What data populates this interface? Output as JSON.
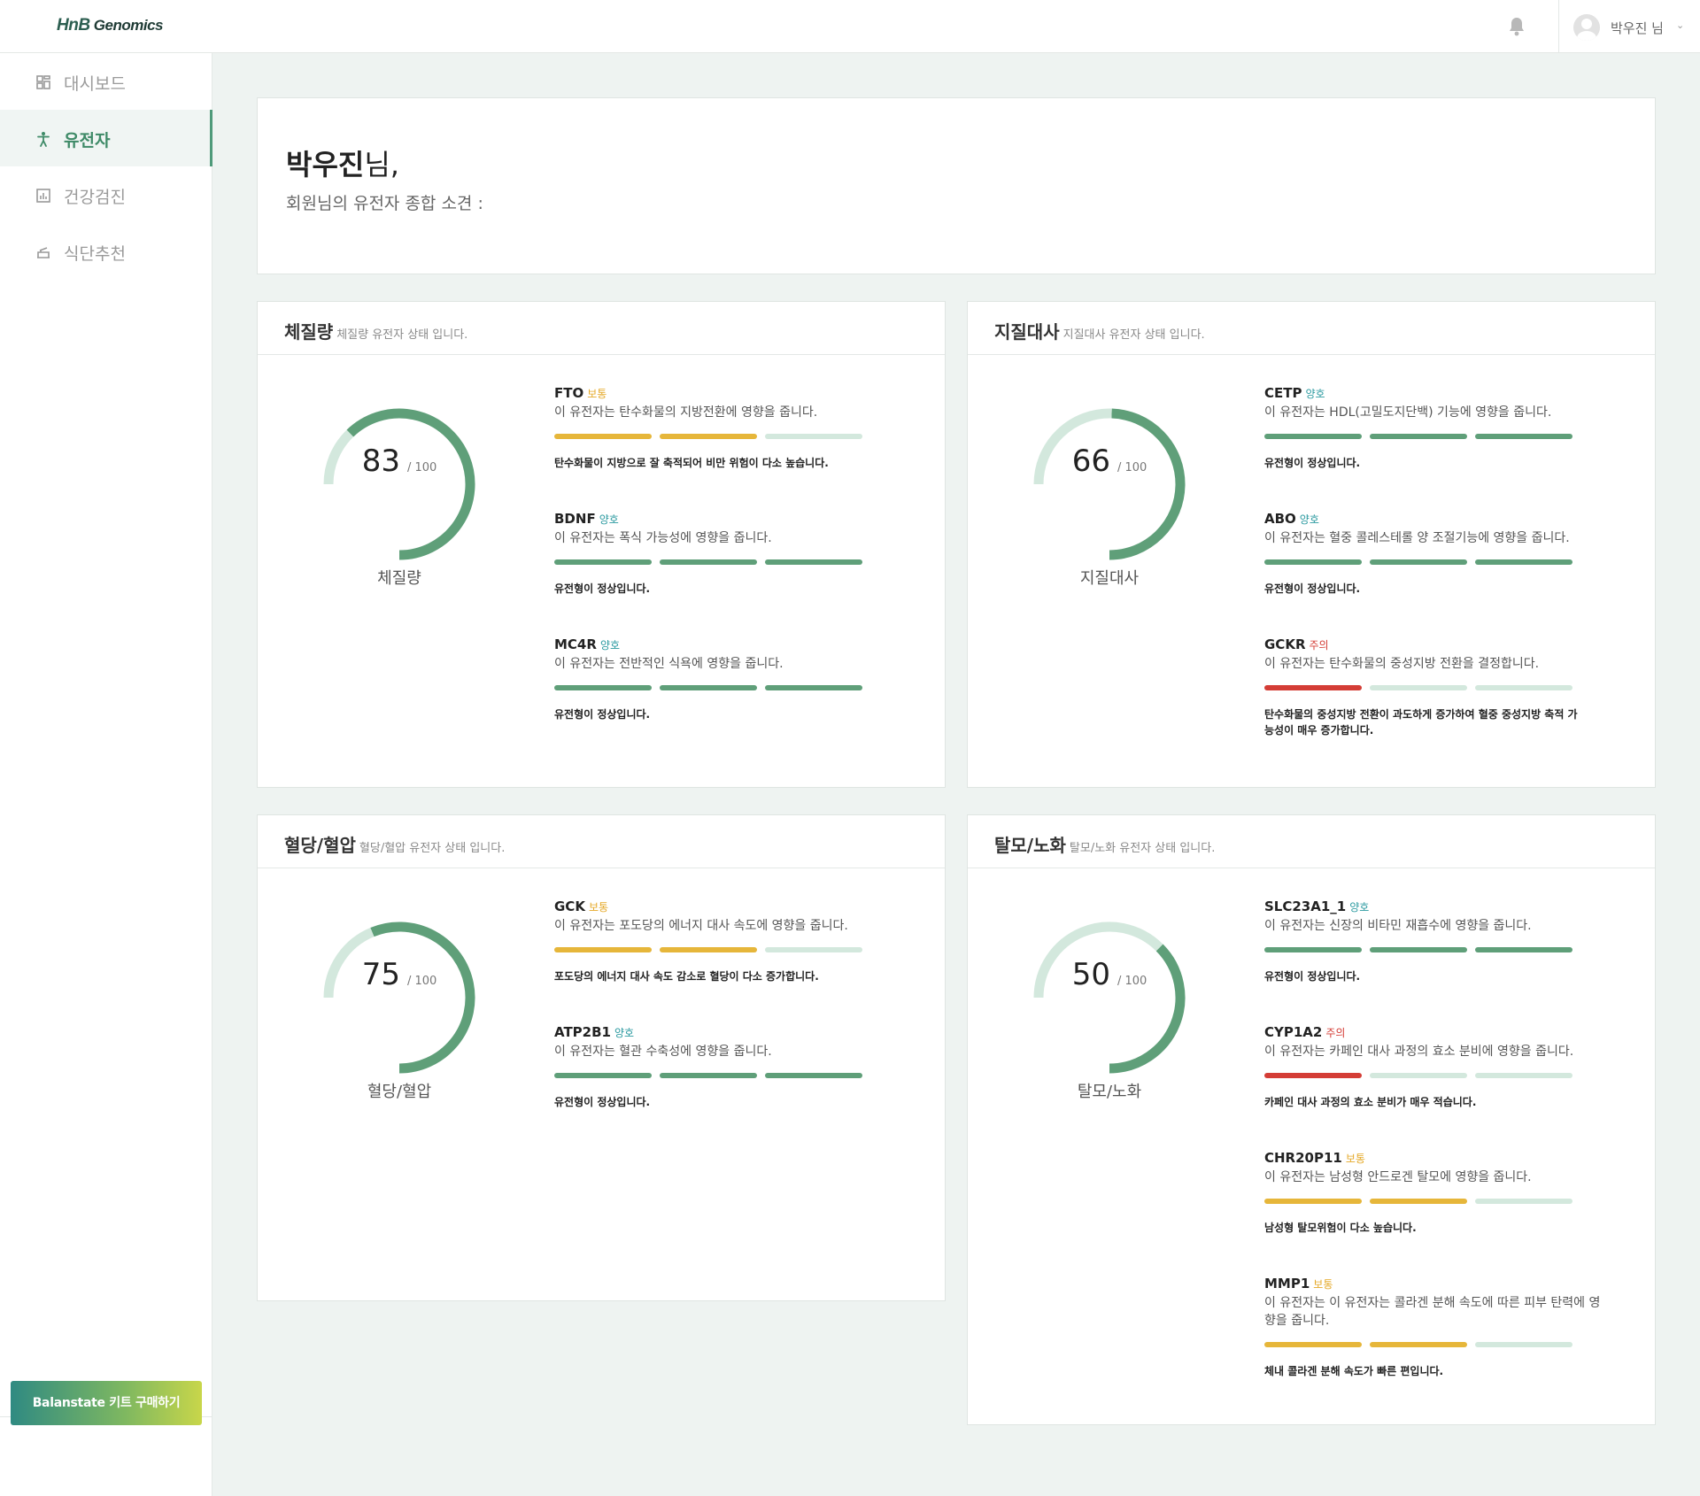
{
  "header": {
    "logo_hnb": "HnB",
    "logo_rest": "Genomics",
    "user_name": "박우진 님",
    "user_chevron": "⌄"
  },
  "sidebar": {
    "items": [
      {
        "label": "대시보드",
        "icon": "dashboard-icon",
        "active": false
      },
      {
        "label": "유전자",
        "icon": "person-icon",
        "active": true
      },
      {
        "label": "건강검진",
        "icon": "chart-icon",
        "active": false
      },
      {
        "label": "식단추천",
        "icon": "food-icon",
        "active": false
      }
    ],
    "buy_button": "Balanstate 키트 구매하기"
  },
  "greeting": {
    "name": "박우진",
    "suffix": "님,",
    "subtitle": "회원님의 유전자 종합 소견 :"
  },
  "colors": {
    "accent": "#5f9f79",
    "track": "#d3e8dd",
    "good": "#2b9aa0",
    "mid": "#e5a928",
    "bad": "#d43d36"
  },
  "cards": [
    {
      "title": "체질량",
      "desc": "체질량 유전자 상태 입니다.",
      "score": 83,
      "max": "/ 100",
      "gauge_label": "체질량",
      "genes": [
        {
          "name": "FTO",
          "status": "보통",
          "level": "mid",
          "desc": "이 유전자는 탄수화물의 지방전환에 영향을 줍니다.",
          "result": "탄수화물이 지방으로 잘 축적되어 비만 위험이 다소 높습니다.",
          "bars": [
            "y",
            "y",
            "t"
          ]
        },
        {
          "name": "BDNF",
          "status": "양호",
          "level": "good",
          "desc": "이 유전자는 폭식 가능성에 영향을 줍니다.",
          "result": "유전형이 정상입니다.",
          "bars": [
            "g",
            "g",
            "g"
          ]
        },
        {
          "name": "MC4R",
          "status": "양호",
          "level": "good",
          "desc": "이 유전자는 전반적인 식욕에 영향을 줍니다.",
          "result": "유전형이 정상입니다.",
          "bars": [
            "g",
            "g",
            "g"
          ]
        }
      ]
    },
    {
      "title": "지질대사",
      "desc": "지질대사 유전자 상태 입니다.",
      "score": 66,
      "max": "/ 100",
      "gauge_label": "지질대사",
      "genes": [
        {
          "name": "CETP",
          "status": "양호",
          "level": "good",
          "desc": "이 유전자는 HDL(고밀도지단백) 기능에 영향을 줍니다.",
          "result": "유전형이 정상입니다.",
          "bars": [
            "g",
            "g",
            "g"
          ]
        },
        {
          "name": "ABO",
          "status": "양호",
          "level": "good",
          "desc": "이 유전자는 혈중 콜레스테롤 양 조절기능에 영향을 줍니다.",
          "result": "유전형이 정상입니다.",
          "bars": [
            "g",
            "g",
            "g"
          ]
        },
        {
          "name": "GCKR",
          "status": "주의",
          "level": "bad",
          "desc": "이 유전자는 탄수화물의 중성지방 전환을 결정합니다.",
          "result": "탄수화물의 중성지방 전환이 과도하게 증가하여 혈중 중성지방 축적 가능성이 매우 증가합니다.",
          "bars": [
            "r",
            "t",
            "t"
          ]
        }
      ]
    },
    {
      "title": "혈당/혈압",
      "desc": "혈당/혈압 유전자 상태 입니다.",
      "score": 75,
      "max": "/ 100",
      "gauge_label": "혈당/혈압",
      "genes": [
        {
          "name": "GCK",
          "status": "보통",
          "level": "mid",
          "desc": "이 유전자는 포도당의 에너지 대사 속도에 영향을 줍니다.",
          "result": "포도당의 에너지 대사 속도 감소로 혈당이 다소 증가합니다.",
          "bars": [
            "y",
            "y",
            "t"
          ]
        },
        {
          "name": "ATP2B1",
          "status": "양호",
          "level": "good",
          "desc": "이 유전자는 혈관 수축성에 영향을 줍니다.",
          "result": "유전형이 정상입니다.",
          "bars": [
            "g",
            "g",
            "g"
          ]
        }
      ]
    },
    {
      "title": "탈모/노화",
      "desc": "탈모/노화 유전자 상태 입니다.",
      "score": 50,
      "max": "/ 100",
      "gauge_label": "탈모/노화",
      "genes": [
        {
          "name": "SLC23A1_1",
          "status": "양호",
          "level": "good",
          "desc": "이 유전자는 신장의 비타민 재흡수에 영향을 줍니다.",
          "result": "유전형이 정상입니다.",
          "bars": [
            "g",
            "g",
            "g"
          ]
        },
        {
          "name": "CYP1A2",
          "status": "주의",
          "level": "bad",
          "desc": "이 유전자는 카페인 대사 과정의 효소 분비에 영향을 줍니다.",
          "result": "카페인 대사 과정의 효소 분비가 매우 적습니다.",
          "bars": [
            "r",
            "t",
            "t"
          ]
        },
        {
          "name": "CHR20P11",
          "status": "보통",
          "level": "mid",
          "desc": "이 유전자는 남성형 안드로겐 탈모에 영향을 줍니다.",
          "result": "남성형 탈모위험이 다소 높습니다.",
          "bars": [
            "y",
            "y",
            "t"
          ]
        },
        {
          "name": "MMP1",
          "status": "보통",
          "level": "mid",
          "desc": "이 유전자는 이 유전자는 콜라겐 분해 속도에 따른 피부 탄력에 영향을 줍니다.",
          "result": "체내 콜라겐 분해 속도가 빠른 편입니다.",
          "bars": [
            "y",
            "y",
            "t"
          ]
        }
      ]
    }
  ]
}
